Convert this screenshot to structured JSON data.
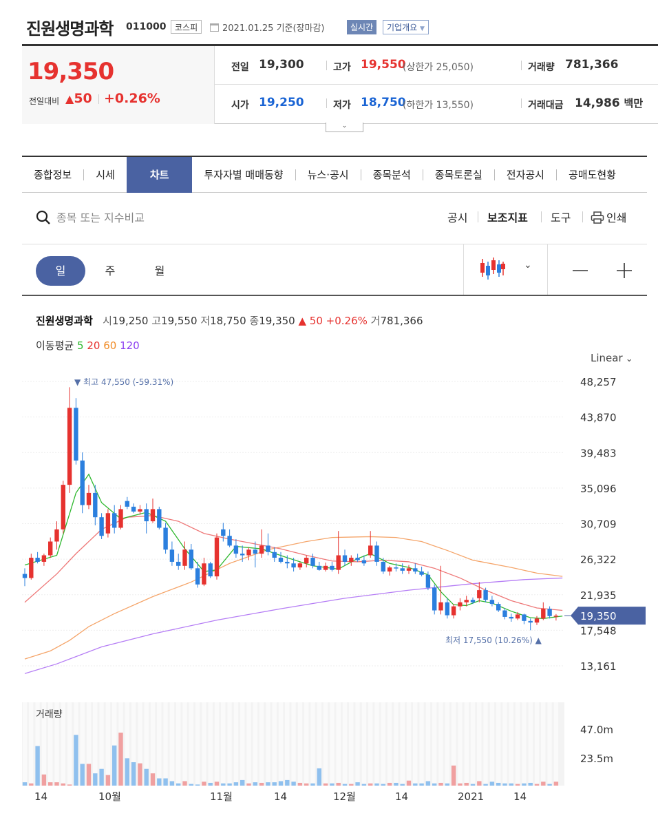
{
  "header": {
    "name": "진원생명과학",
    "code": "011000",
    "market": "코스피",
    "date": "2021.01.25 기준(장마감)",
    "live": "실시간",
    "overview": "기업개요"
  },
  "quote": {
    "price": "19,350",
    "change_label": "전일대비",
    "change": "50",
    "change_pct": "+0.26%",
    "prev_label": "전일",
    "prev": "19,300",
    "high_label": "고가",
    "high": "19,550",
    "upper": "(상한가 25,050)",
    "volume_label": "거래량",
    "volume": "781,366",
    "open_label": "시가",
    "open": "19,250",
    "low_label": "저가",
    "low": "18,750",
    "lower": "(하한가 13,550)",
    "amount_label": "거래대금",
    "amount": "14,986",
    "amount_unit": "백만"
  },
  "tabs": [
    "종합정보",
    "시세",
    "차트",
    "투자자별 매매동향",
    "뉴스·공시",
    "종목분석",
    "종목토론실",
    "전자공시",
    "공매도현황"
  ],
  "toolbar": {
    "search_placeholder": "종목 또는 지수비교",
    "items": [
      "공시",
      "보조지표",
      "도구"
    ],
    "print": "인쇄"
  },
  "periods": [
    "일",
    "주",
    "월"
  ],
  "chart": {
    "summary_name": "진원생명과학",
    "s_open_l": "시",
    "s_open": "19,250",
    "s_high_l": "고",
    "s_high": "19,550",
    "s_low_l": "저",
    "s_low": "18,750",
    "s_close_l": "종",
    "s_close": "19,350",
    "s_chg": "▲ 50 +0.26%",
    "s_vol_l": "거",
    "s_vol": "781,366",
    "ma_label": "이동평균",
    "ma": [
      {
        "n": "5",
        "color": "#2eb82e"
      },
      {
        "n": "20",
        "color": "#e6322f"
      },
      {
        "n": "60",
        "color": "#f08c28"
      },
      {
        "n": "120",
        "color": "#8a3cf0"
      }
    ],
    "scale": "Linear",
    "max_note": "▼ 최고  47,550 (-59.31%)",
    "min_note": "최저  17,550 (10.26%) ▲",
    "current": "19,350",
    "volume_title": "거래량",
    "vol_ticks": [
      "47.0m",
      "23.5m"
    ]
  },
  "chart_data": {
    "type": "candlestick",
    "y_ticks": [
      48257,
      43870,
      39483,
      35096,
      30709,
      26322,
      21935,
      17548,
      13161
    ],
    "ylim": [
      11000,
      50000
    ],
    "x_ticks": [
      "14",
      "10월",
      "11월",
      "14",
      "12월",
      "14",
      "2021",
      "14"
    ],
    "highest": 47550,
    "lowest": 17550,
    "last": 19350,
    "colors": {
      "up": "#e6322f",
      "down": "#2b7fde",
      "ma5": "#2eb82e",
      "ma20": "#ee7777",
      "ma60": "#f5a56a",
      "ma120": "#b57df5"
    },
    "candles": [
      [
        24500,
        25200,
        23000,
        24000
      ],
      [
        24000,
        27000,
        23800,
        26500
      ],
      [
        26500,
        27200,
        25800,
        26000
      ],
      [
        26000,
        27000,
        25500,
        26800
      ],
      [
        26800,
        29000,
        26500,
        28500
      ],
      [
        28500,
        31000,
        27500,
        30000
      ],
      [
        30000,
        36000,
        29500,
        35500
      ],
      [
        35500,
        47550,
        34500,
        45000
      ],
      [
        45000,
        46200,
        38000,
        38500
      ],
      [
        38500,
        39500,
        32000,
        33000
      ],
      [
        33000,
        35500,
        32500,
        34500
      ],
      [
        34500,
        35500,
        30500,
        31500
      ],
      [
        31500,
        32000,
        28800,
        29200
      ],
      [
        29500,
        32500,
        29000,
        32000
      ],
      [
        32000,
        33000,
        29500,
        30200
      ],
      [
        30200,
        33000,
        30000,
        32500
      ],
      [
        33500,
        34000,
        32500,
        32800
      ],
      [
        32800,
        33200,
        32000,
        32200
      ],
      [
        32200,
        33000,
        31800,
        32500
      ],
      [
        32500,
        33200,
        29500,
        31000
      ],
      [
        31000,
        33800,
        30800,
        32500
      ],
      [
        32500,
        32800,
        30000,
        30200
      ],
      [
        30200,
        30800,
        27000,
        27500
      ],
      [
        27500,
        28500,
        25500,
        26000
      ],
      [
        26000,
        27000,
        25000,
        25500
      ],
      [
        25500,
        28500,
        25000,
        27500
      ],
      [
        27500,
        28200,
        25000,
        25200
      ],
      [
        25200,
        26000,
        22800,
        23200
      ],
      [
        23200,
        26500,
        23000,
        25800
      ],
      [
        25800,
        26000,
        24000,
        24200
      ],
      [
        24200,
        29500,
        23800,
        29000
      ],
      [
        30000,
        30800,
        28500,
        29200
      ],
      [
        29200,
        30000,
        27800,
        28000
      ],
      [
        28000,
        28800,
        26500,
        27000
      ],
      [
        27000,
        28000,
        26000,
        26800
      ],
      [
        26800,
        27800,
        26200,
        27500
      ],
      [
        27500,
        28500,
        25300,
        27000
      ],
      [
        27000,
        30000,
        26500,
        28000
      ],
      [
        28000,
        29500,
        26800,
        27200
      ],
      [
        27200,
        27800,
        26000,
        26500
      ],
      [
        26500,
        27200,
        25800,
        26000
      ],
      [
        26000,
        26800,
        25200,
        25800
      ],
      [
        25800,
        26500,
        24800,
        25300
      ],
      [
        25300,
        26000,
        25000,
        25800
      ],
      [
        25800,
        26800,
        25300,
        26500
      ],
      [
        26500,
        27000,
        25200,
        25500
      ],
      [
        25500,
        26000,
        24900,
        25000
      ],
      [
        25000,
        25900,
        24800,
        25500
      ],
      [
        25500,
        26000,
        24800,
        25000
      ],
      [
        25000,
        29800,
        24500,
        26800
      ],
      [
        26800,
        27500,
        25500,
        26000
      ],
      [
        26000,
        26800,
        25500,
        26500
      ],
      [
        26500,
        27000,
        26000,
        26200
      ],
      [
        26200,
        26800,
        25500,
        25800
      ],
      [
        26800,
        29800,
        26500,
        28000
      ],
      [
        28000,
        28500,
        25500,
        26000
      ],
      [
        26000,
        26500,
        24500,
        24800
      ],
      [
        24800,
        25500,
        24300,
        25300
      ],
      [
        25300,
        25800,
        24800,
        25200
      ],
      [
        25200,
        25800,
        24500,
        24900
      ],
      [
        24900,
        25600,
        24500,
        25200
      ],
      [
        25200,
        25800,
        24500,
        24800
      ],
      [
        24800,
        25400,
        24200,
        24400
      ],
      [
        24400,
        24800,
        22500,
        22800
      ],
      [
        22800,
        23200,
        19500,
        20000
      ],
      [
        20000,
        25500,
        19500,
        21000
      ],
      [
        21000,
        21500,
        19000,
        19400
      ],
      [
        19400,
        20800,
        19000,
        20500
      ],
      [
        20500,
        21500,
        20000,
        21000
      ],
      [
        21000,
        21800,
        20500,
        21300
      ],
      [
        21300,
        21600,
        20800,
        21000
      ],
      [
        21500,
        23500,
        21000,
        22500
      ],
      [
        22500,
        22800,
        21000,
        21300
      ],
      [
        21300,
        21800,
        20500,
        20800
      ],
      [
        20800,
        21000,
        19800,
        20000
      ],
      [
        20000,
        20300,
        18900,
        19200
      ],
      [
        19200,
        19600,
        18600,
        19000
      ],
      [
        19000,
        19800,
        18800,
        19500
      ],
      [
        19500,
        19600,
        18300,
        18700
      ],
      [
        18700,
        19000,
        17550,
        18500
      ],
      [
        18500,
        19300,
        18200,
        19000
      ],
      [
        19000,
        21000,
        18800,
        20200
      ],
      [
        20200,
        20500,
        19000,
        19300
      ],
      [
        19250,
        19550,
        18750,
        19350
      ]
    ],
    "volumes": [
      0.06,
      0.04,
      0.71,
      0.2,
      0.06,
      0.06,
      0.04,
      0.02,
      0.91,
      0.39,
      0.39,
      0.22,
      0.3,
      0.19,
      0.72,
      0.95,
      0.49,
      0.42,
      0.4,
      0.3,
      0.22,
      0.13,
      0.13,
      0.08,
      0.04,
      0.08,
      0.03,
      0.02,
      0.07,
      0.05,
      0.07,
      0.04,
      0.04,
      0.06,
      0.1,
      0.04,
      0.06,
      0.05,
      0.06,
      0.06,
      0.08,
      0.1,
      0.07,
      0.05,
      0.04,
      0.04,
      0.31,
      0.04,
      0.04,
      0.05,
      0.03,
      0.03,
      0.06,
      0.03,
      0.04,
      0.04,
      0.03,
      0.05,
      0.05,
      0.03,
      0.09,
      0.04,
      0.04,
      0.08,
      0.04,
      0.05,
      0.04,
      0.36,
      0.04,
      0.05,
      0.03,
      0.08,
      0.03,
      0.07,
      0.05,
      0.04,
      0.04,
      0.03,
      0.04,
      0.05,
      0.03,
      0.07,
      0.03,
      0.07,
      0.04,
      0.03,
      0.07,
      0.06,
      0.03,
      0.09,
      0.02
    ],
    "ma": {
      "ma5": [
        [
          0,
          25600
        ],
        [
          5,
          26800
        ],
        [
          8,
          34500
        ],
        [
          10,
          36800
        ],
        [
          12,
          33300
        ],
        [
          15,
          31300
        ],
        [
          19,
          32100
        ],
        [
          22,
          31000
        ],
        [
          25,
          27600
        ],
        [
          28,
          24800
        ],
        [
          30,
          25000
        ],
        [
          33,
          27900
        ],
        [
          37,
          27600
        ],
        [
          41,
          26500
        ],
        [
          45,
          25500
        ],
        [
          49,
          25100
        ],
        [
          52,
          26400
        ],
        [
          54,
          27000
        ],
        [
          57,
          25800
        ],
        [
          60,
          25300
        ],
        [
          63,
          24400
        ],
        [
          65,
          22300
        ],
        [
          67,
          20700
        ],
        [
          69,
          20600
        ],
        [
          71,
          21200
        ],
        [
          73,
          20900
        ],
        [
          76,
          19900
        ],
        [
          79,
          19100
        ],
        [
          81,
          19000
        ],
        [
          84,
          19300
        ]
      ],
      "ma20": [
        [
          0,
          21000
        ],
        [
          5,
          24500
        ],
        [
          8,
          27000
        ],
        [
          12,
          30000
        ],
        [
          16,
          31500
        ],
        [
          20,
          31700
        ],
        [
          24,
          31000
        ],
        [
          28,
          29500
        ],
        [
          32,
          28800
        ],
        [
          36,
          28200
        ],
        [
          40,
          27600
        ],
        [
          44,
          26800
        ],
        [
          48,
          26100
        ],
        [
          52,
          26000
        ],
        [
          56,
          26200
        ],
        [
          60,
          26000
        ],
        [
          64,
          25200
        ],
        [
          68,
          24000
        ],
        [
          72,
          22500
        ],
        [
          76,
          21200
        ],
        [
          80,
          20300
        ],
        [
          84,
          20000
        ]
      ],
      "ma60": [
        [
          0,
          14000
        ],
        [
          4,
          15000
        ],
        [
          7,
          16300
        ],
        [
          10,
          18000
        ],
        [
          14,
          19600
        ],
        [
          20,
          21700
        ],
        [
          26,
          23500
        ],
        [
          32,
          25800
        ],
        [
          38,
          27500
        ],
        [
          44,
          28500
        ],
        [
          48,
          29000
        ],
        [
          54,
          29100
        ],
        [
          58,
          29000
        ],
        [
          62,
          28500
        ],
        [
          66,
          27400
        ],
        [
          70,
          26200
        ],
        [
          76,
          25300
        ],
        [
          80,
          24600
        ],
        [
          84,
          24200
        ]
      ],
      "ma120": [
        [
          0,
          12200
        ],
        [
          5,
          13400
        ],
        [
          8,
          14300
        ],
        [
          12,
          15500
        ],
        [
          20,
          17100
        ],
        [
          30,
          18800
        ],
        [
          40,
          20200
        ],
        [
          50,
          21500
        ],
        [
          60,
          22500
        ],
        [
          70,
          23300
        ],
        [
          78,
          23800
        ],
        [
          84,
          24000
        ]
      ]
    }
  }
}
